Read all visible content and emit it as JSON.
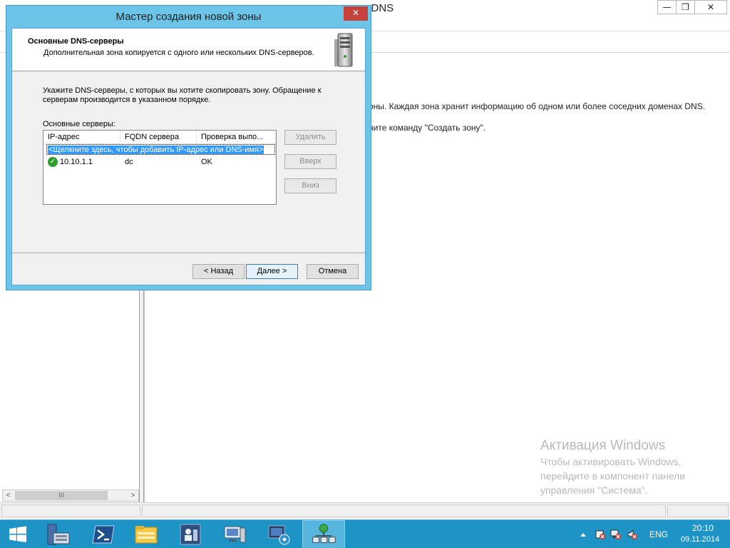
{
  "background_window": {
    "title_partial": "р DNS",
    "controls": {
      "minimize": "—",
      "maximize": "❐",
      "close": "✕"
    },
    "info_line_1": "оны. Каждая зона хранит информацию об одном или более соседних доменах DNS.",
    "info_line_2": "ните команду \"Создать зону\".",
    "scrollbar_left_arrow": "<",
    "scrollbar_thumb_label": "III",
    "scrollbar_right_arrow": ">"
  },
  "wizard": {
    "title": "Мастер создания новой зоны",
    "close_label": "✕",
    "heading": "Основные DNS-серверы",
    "subheading": "Дополнительная зона копируется с одного или нескольких DNS-серверов.",
    "instruction_line_1": "Укажите DNS-серверы, с которых вы хотите скопировать зону.  Обращение к",
    "instruction_line_2": "серверам производится в указанном порядке.",
    "list_label": "Основные серверы:",
    "columns": [
      "IP-адрес",
      "FQDN сервера",
      "Проверка выпо..."
    ],
    "add_row_text": "<Щелкните здесь, чтобы добавить IP-адрес или DNS-имя>",
    "rows": [
      {
        "ip": "10.10.1.1",
        "fqdn": "dc",
        "status": "OK",
        "icon": "check-ok-icon"
      }
    ],
    "buttons": {
      "delete": "Удалить",
      "up": "Вверх",
      "down": "Вниз",
      "back": "< Назад",
      "next": "Далее >",
      "cancel": "Отмена"
    }
  },
  "activation": {
    "title": "Активация Windows",
    "line1": "Чтобы активировать Windows,",
    "line2": "перейдите в компонент панели",
    "line3": "управления \"Система\"."
  },
  "taskbar": {
    "apps": [
      "start-icon",
      "server-manager-icon",
      "powershell-icon",
      "file-explorer-icon",
      "active-directory-icon",
      "computer-management-icon",
      "network-icon",
      "dns-manager-icon"
    ],
    "language": "ENG",
    "time": "20:10",
    "date": "09.11.2014"
  },
  "colors": {
    "taskbar": "#1e93c6",
    "wizard_frame": "#6cc4e8",
    "close_button": "#c7413b",
    "selection": "#3399ff"
  }
}
